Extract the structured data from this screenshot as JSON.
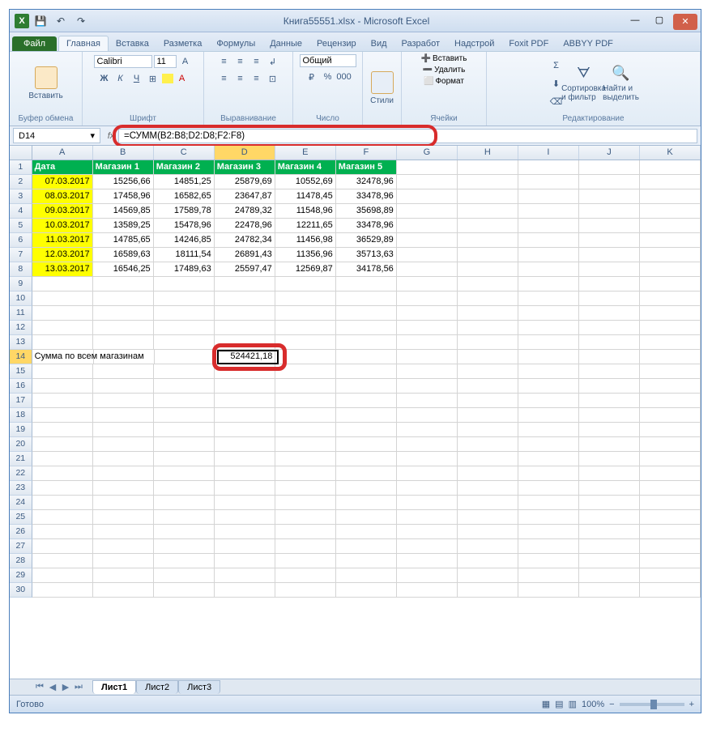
{
  "window": {
    "title": "Книга55551.xlsx - Microsoft Excel"
  },
  "qa": {
    "logo": "X"
  },
  "ribbon": {
    "file": "Файл",
    "tabs": [
      "Главная",
      "Вставка",
      "Разметка",
      "Формулы",
      "Данные",
      "Рецензир",
      "Вид",
      "Разработ",
      "Надстрой",
      "Foxit PDF",
      "ABBYY PDF"
    ],
    "active_tab": 0,
    "groups": {
      "clipboard": {
        "label": "Буфер обмена",
        "paste": "Вставить"
      },
      "font": {
        "label": "Шрифт",
        "name": "Calibri",
        "size": "11"
      },
      "alignment": {
        "label": "Выравнивание"
      },
      "number": {
        "label": "Число",
        "format": "Общий"
      },
      "styles": {
        "label": "Стили",
        "btn": "Стили"
      },
      "cells": {
        "label": "Ячейки",
        "insert": "Вставить",
        "delete": "Удалить",
        "format": "Формат"
      },
      "editing": {
        "label": "Редактирование",
        "sort": "Сортировка и фильтр",
        "find": "Найти и выделить"
      }
    }
  },
  "formula_bar": {
    "name_box": "D14",
    "fx": "fx",
    "formula": "=СУММ(B2:B8;D2:D8;F2:F8)"
  },
  "columns": [
    "A",
    "B",
    "C",
    "D",
    "E",
    "F",
    "G",
    "H",
    "I",
    "J",
    "K"
  ],
  "headers": [
    "Дата",
    "Магазин 1",
    "Магазин 2",
    "Магазин 3",
    "Магазин 4",
    "Магазин 5"
  ],
  "rows": [
    {
      "n": 1,
      "date": "Дата"
    },
    {
      "n": 2,
      "date": "07.03.2017",
      "v": [
        "15256,66",
        "14851,25",
        "25879,69",
        "10552,69",
        "32478,96"
      ]
    },
    {
      "n": 3,
      "date": "08.03.2017",
      "v": [
        "17458,96",
        "16582,65",
        "23647,87",
        "11478,45",
        "33478,96"
      ]
    },
    {
      "n": 4,
      "date": "09.03.2017",
      "v": [
        "14569,85",
        "17589,78",
        "24789,32",
        "11548,96",
        "35698,89"
      ]
    },
    {
      "n": 5,
      "date": "10.03.2017",
      "v": [
        "13589,25",
        "15478,96",
        "22478,96",
        "12211,65",
        "33478,96"
      ]
    },
    {
      "n": 6,
      "date": "11.03.2017",
      "v": [
        "14785,65",
        "14246,85",
        "24782,34",
        "11456,98",
        "36529,89"
      ]
    },
    {
      "n": 7,
      "date": "12.03.2017",
      "v": [
        "16589,63",
        "18111,54",
        "26891,43",
        "11356,96",
        "35713,63"
      ]
    },
    {
      "n": 8,
      "date": "13.03.2017",
      "v": [
        "16546,25",
        "17489,63",
        "25597,47",
        "12569,87",
        "34178,56"
      ]
    }
  ],
  "sum_label": "Сумма по всем магазинам",
  "sum_value": "524421,18",
  "sheets": [
    "Лист1",
    "Лист2",
    "Лист3"
  ],
  "status": {
    "ready": "Готово",
    "zoom": "100%"
  }
}
